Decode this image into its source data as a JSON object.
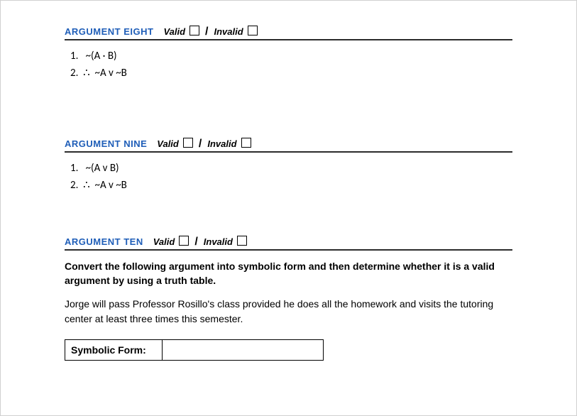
{
  "labels": {
    "valid": "Valid",
    "invalid": "Invalid",
    "symbolic_form": "Symbolic Form:"
  },
  "sections": {
    "eight": {
      "title": "ARGUMENT EIGHT",
      "premises": [
        "1.   ~(A · B)",
        "2.  ∴  ~A v ~B"
      ]
    },
    "nine": {
      "title": "ARGUMENT NINE",
      "premises": [
        "1.   ~(A v B)",
        "2.  ∴  ~A v ~B"
      ]
    },
    "ten": {
      "title": "ARGUMENT TEN",
      "instructions": "Convert the following argument into symbolic form and then determine whether it is a valid argument by using a truth table.",
      "body": "Jorge will pass Professor Rosillo's class provided he does all the homework and visits the tutoring center at least three times this semester.",
      "symbolic_form_value": ""
    }
  }
}
